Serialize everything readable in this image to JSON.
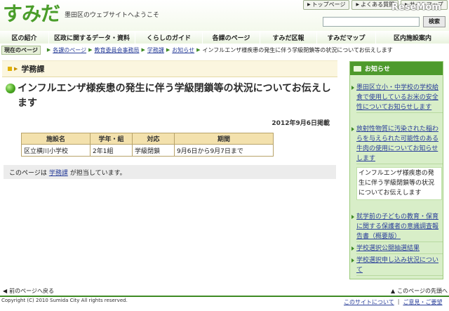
{
  "header": {
    "logo": "すみだ",
    "tagline": "墨田区のウェブサイトへようこそ",
    "top_links": [
      "トップページ",
      "よくある質問",
      "サイトマップ"
    ],
    "brand_mark": "ReseMom",
    "search_button": "検索",
    "search_value": ""
  },
  "nav": {
    "items": [
      "区の紹介",
      "区政に関するデータ・資料",
      "くらしのガイド",
      "各課のページ",
      "すみだ区報",
      "すみだマップ",
      "区内施設案内"
    ]
  },
  "breadcrumb": {
    "current_label": "現在のページ",
    "items": [
      "各課のページ",
      "教育委員会事務局",
      "学務課",
      "お知らせ"
    ],
    "here": "インフルエンザ様疾患の発生に伴う学級閉鎖等の状況についてお伝えします"
  },
  "main": {
    "dept_name": "学務課",
    "title": "インフルエンザ様疾患の発生に伴う学級閉鎖等の状況についてお伝えします",
    "published": "2012年9月6日掲載",
    "table": {
      "headers": [
        "施設名",
        "学年・組",
        "対応",
        "期間"
      ],
      "rows": [
        [
          "区立横川小学校",
          "2年1組",
          "学級閉鎖",
          "9月6日から9月7日まで"
        ]
      ]
    },
    "owner_prefix": "このページは",
    "owner_link": "学務課",
    "owner_suffix": "が担当しています。"
  },
  "sidebar": {
    "title": "お知らせ",
    "items": [
      "墨田区立小・中学校の学校給食で使用しているお米の安全性についてお知らせします",
      "放射性物質に汚染された稲わらを与えられた可能性のある牛肉の使用についてお知らせします",
      "インフルエンザ様疾患の発生に伴う学級閉鎖等の状況についてお伝えします",
      "就学前の子どもの教育・保育に関する保護者の意識調査報告書（概要版）",
      "学校選択公開抽選結果",
      "学校選択申し込み状況について"
    ],
    "current_index": 2
  },
  "footer": {
    "back": "前のページへ戻る",
    "to_top": "このページの先頭へ",
    "copyright": "Copyright (C) 2010 Sumida City All rights reserved.",
    "links": [
      "このサイトについて",
      "ご意見・ご要望"
    ]
  },
  "colors": {
    "brand_green": "#3e8a24",
    "logo_green": "#4a9d2a",
    "sidebar_bg": "#d8eec8",
    "table_header": "#f3e1ad"
  }
}
